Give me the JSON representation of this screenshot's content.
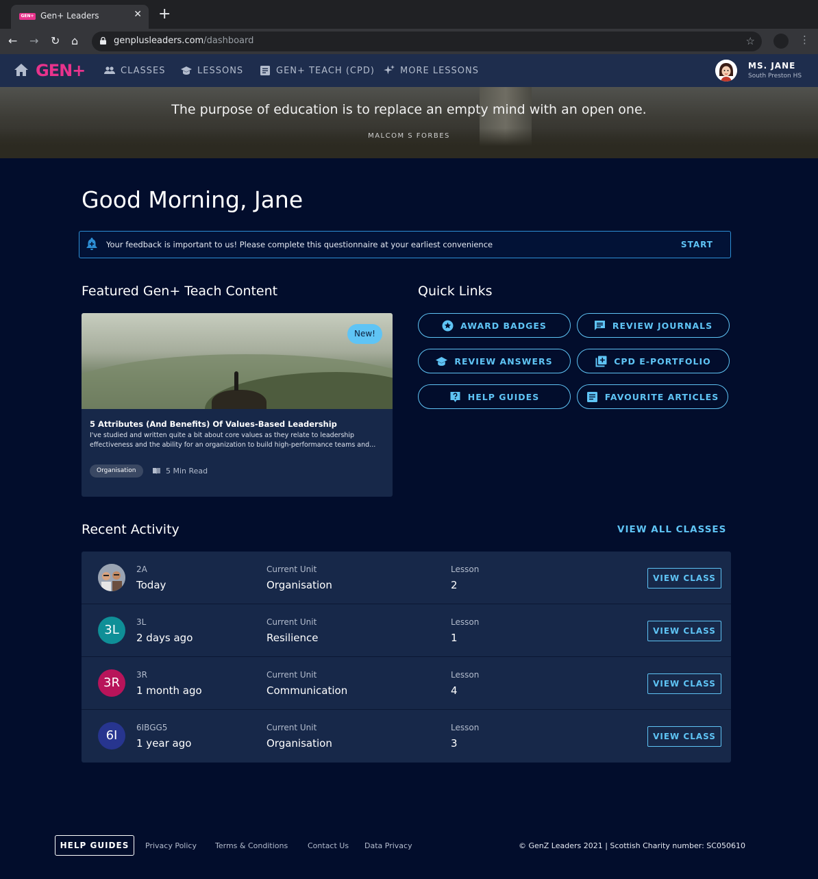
{
  "browser": {
    "tab_title": "Gen+ Leaders",
    "tab_favicon_text": "GEN+",
    "url_domain": "genplusleaders.com",
    "url_path": "/dashboard"
  },
  "header": {
    "logo": "GEN+",
    "nav": [
      {
        "label": "CLASSES",
        "icon": "people-icon"
      },
      {
        "label": "LESSONS",
        "icon": "school-icon"
      },
      {
        "label": "GEN+ TEACH (CPD)",
        "icon": "article-icon"
      },
      {
        "label": "MORE LESSONS",
        "icon": "sparkle-icon"
      }
    ],
    "user_name": "MS. JANE",
    "user_school": "South Preston HS"
  },
  "hero": {
    "quote": "The purpose of education is to replace an empty mind with an open one.",
    "author": "MALCOM S FORBES"
  },
  "greeting": "Good Morning, Jane",
  "notice": {
    "text": "Your feedback is important to us! Please complete this questionnaire at your earliest convenience",
    "action": "START"
  },
  "featured": {
    "section_title": "Featured Gen+ Teach Content",
    "badge": "New!",
    "title": "5 Attributes (And Benefits) Of Values-Based Leadership",
    "description": "I've studied and written quite a bit about core values as they relate to leadership effectiveness and the ability for an organization to build high-performance teams and...",
    "tag": "Organisation",
    "read_time": "5 Min Read"
  },
  "quick_links": {
    "section_title": "Quick Links",
    "items": [
      {
        "label": "AWARD BADGES",
        "icon": "star-badge-icon"
      },
      {
        "label": "REVIEW JOURNALS",
        "icon": "chat-icon"
      },
      {
        "label": "REVIEW ANSWERS",
        "icon": "school-icon"
      },
      {
        "label": "CPD E-PORTFOLIO",
        "icon": "library-add-icon"
      },
      {
        "label": "HELP GUIDES",
        "icon": "help-icon"
      },
      {
        "label": "FAVOURITE ARTICLES",
        "icon": "article-icon"
      }
    ]
  },
  "activity": {
    "section_title": "Recent Activity",
    "view_all": "VIEW ALL CLASSES",
    "unit_label": "Current Unit",
    "lesson_label": "Lesson",
    "button_label": "VIEW CLASS",
    "rows": [
      {
        "avatar": "",
        "avatar_color": "#8a8f99",
        "class": "2A",
        "time": "Today",
        "unit": "Organisation",
        "lesson": "2"
      },
      {
        "avatar": "3L",
        "avatar_color": "#0f8f97",
        "class": "3L",
        "time": "2 days ago",
        "unit": "Resilience",
        "lesson": "1"
      },
      {
        "avatar": "3R",
        "avatar_color": "#b8145a",
        "class": "3R",
        "time": "1 month ago",
        "unit": "Communication",
        "lesson": "4"
      },
      {
        "avatar": "6I",
        "avatar_color": "#27358f",
        "class": "6IBGG5",
        "time": "1 year ago",
        "unit": "Organisation",
        "lesson": "3"
      }
    ]
  },
  "footer": {
    "help": "HELP GUIDES",
    "links": [
      "Privacy Policy",
      "Terms & Conditions",
      "Contact Us",
      "Data Privacy"
    ],
    "copyright": "© GenZ Leaders 2021 | Scottish Charity number: SC050610"
  },
  "colors": {
    "accent": "#5fc4f5",
    "brand": "#e8338c",
    "background": "#020d2c",
    "card": "#172849"
  }
}
